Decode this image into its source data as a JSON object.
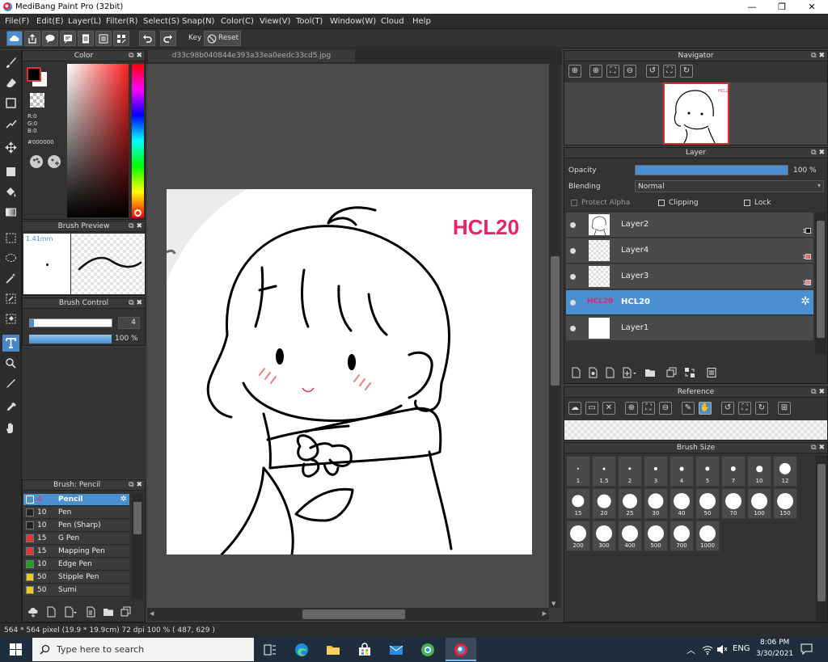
{
  "window": {
    "title": "MediBang Paint Pro (32bit)",
    "minimize_glyph": "—",
    "maximize_glyph": "❐",
    "close_glyph": "✕"
  },
  "menu": [
    "File(F)",
    "Edit(E)",
    "Layer(L)",
    "Filter(R)",
    "Select(S)",
    "Snap(N)",
    "Color(C)",
    "View(V)",
    "Tool(T)",
    "Window(W)",
    "Cloud",
    "Help"
  ],
  "toolbar": {
    "key_label": "Key",
    "reset_label": "Reset"
  },
  "color_panel": {
    "title": "Color",
    "r": "R:0",
    "g": "G:0",
    "b": "B:0",
    "hex": "#000000",
    "foreground": "#000000",
    "background": "#ffffff"
  },
  "brush_preview": {
    "title": "Brush Preview",
    "size": "1.41mm"
  },
  "brush_control": {
    "title": "Brush Control",
    "size_value": "4",
    "opacity_value": "100 %"
  },
  "brush_list": {
    "title": "Brush: Pencil",
    "items": [
      {
        "size": "4",
        "name": "Pencil",
        "color": "#4a8fd0"
      },
      {
        "size": "10",
        "name": "Pen",
        "color": "#222222"
      },
      {
        "size": "10",
        "name": "Pen (Sharp)",
        "color": "#222222"
      },
      {
        "size": "15",
        "name": "G Pen",
        "color": "#e83030"
      },
      {
        "size": "15",
        "name": "Mapping Pen",
        "color": "#e83030"
      },
      {
        "size": "10",
        "name": "Edge Pen",
        "color": "#20a020"
      },
      {
        "size": "50",
        "name": "Stipple Pen",
        "color": "#e8d020"
      },
      {
        "size": "50",
        "name": "Sumi",
        "color": "#e8d020"
      }
    ]
  },
  "document": {
    "tab": "d33c98b040844e393a33ea0eedc33cd5.jpg",
    "canvas_text": "HCL20",
    "accent": "#e5246a"
  },
  "navigator": {
    "title": "Navigator"
  },
  "layer_panel": {
    "title": "Layer",
    "opacity_label": "Opacity",
    "opacity_value": "100 %",
    "opacity_fraction": 1.0,
    "blending_label": "Blending",
    "blending_value": "Normal",
    "protect_alpha": "Protect Alpha",
    "clipping": "Clipping",
    "lock": "Lock",
    "layers": [
      {
        "name": "Layer2",
        "num": "1",
        "swatch": "#111111",
        "thumb": "sketch"
      },
      {
        "name": "Layer4",
        "num": "1",
        "swatch": "#ee6655",
        "thumb": "empty"
      },
      {
        "name": "Layer3",
        "num": "1",
        "swatch": "#f08888",
        "thumb": "empty"
      },
      {
        "name": "HCL20",
        "num": "",
        "swatch": "",
        "thumb": "text"
      },
      {
        "name": "Layer1",
        "num": "",
        "swatch": "",
        "thumb": "white"
      }
    ]
  },
  "reference": {
    "title": "Reference"
  },
  "brush_size": {
    "title": "Brush Size",
    "sizes": [
      "1",
      "1.5",
      "2",
      "3",
      "4",
      "5",
      "7",
      "10",
      "12",
      "15",
      "20",
      "25",
      "30",
      "40",
      "50",
      "70",
      "100",
      "150",
      "200",
      "300",
      "400",
      "500",
      "700",
      "1000"
    ]
  },
  "status": {
    "text": "564 * 564 pixel  (19.9 * 19.9cm)  72 dpi  100 %  ( 487, 629 )"
  },
  "taskbar": {
    "search_placeholder": "Type here to search",
    "lang": "ENG",
    "time": "8:06 PM",
    "date": "3/30/2021"
  }
}
